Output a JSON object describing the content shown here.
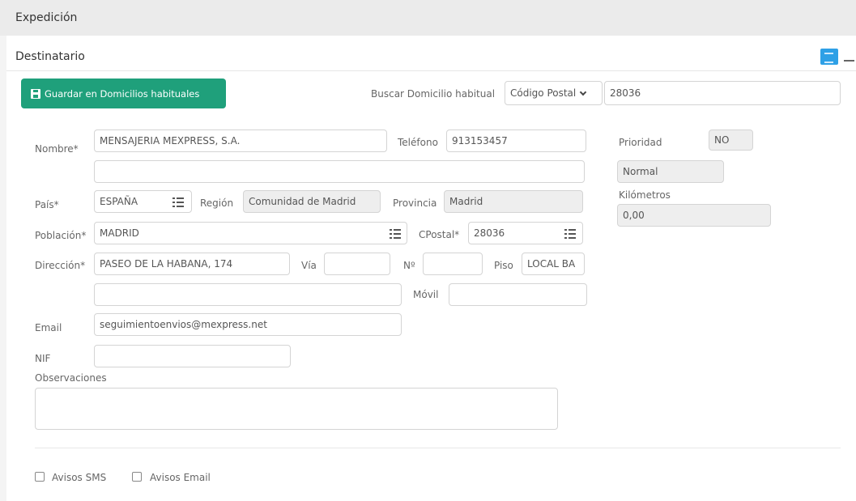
{
  "header": {
    "title": "Expedición"
  },
  "section": {
    "title": "Destinatario"
  },
  "toolbar": {
    "save_label": "Guardar en Domicilios habituales"
  },
  "search": {
    "label": "Buscar Domicilio habitual",
    "type_selected": "Código Postal",
    "value": "28036"
  },
  "form": {
    "nombre_label": "Nombre*",
    "nombre": "MENSAJERIA MEXPRESS, S.A.",
    "nombre2": "",
    "telefono_label": "Teléfono",
    "telefono": "913153457",
    "pais_label": "País*",
    "pais": "ESPAÑA",
    "region_label": "Región",
    "region": "Comunidad de Madrid",
    "provincia_label": "Provincia",
    "provincia": "Madrid",
    "poblacion_label": "Población*",
    "poblacion": "MADRID",
    "cpostal_label": "CPostal*",
    "cpostal": "28036",
    "direccion_label": "Dirección*",
    "direccion": "PASEO DE LA HABANA, 174",
    "via_label": "Vía",
    "via": "",
    "numero_label": "Nº",
    "numero": "",
    "piso_label": "Piso",
    "piso": "LOCAL BA",
    "direccion2": "",
    "movil_label": "Móvil",
    "movil": "",
    "email_label": "Email",
    "email": "seguimientoenvios@mexpress.net",
    "nif_label": "NIF",
    "nif": "",
    "observaciones_label": "Observaciones",
    "observaciones": ""
  },
  "side": {
    "prioridad_label": "Prioridad",
    "prioridad": "NO",
    "tipo": "Normal",
    "kilometros_label": "Kilómetros",
    "kilometros": "0,00"
  },
  "avisos": {
    "sms_label": "Avisos SMS",
    "email_label": "Avisos Email"
  }
}
